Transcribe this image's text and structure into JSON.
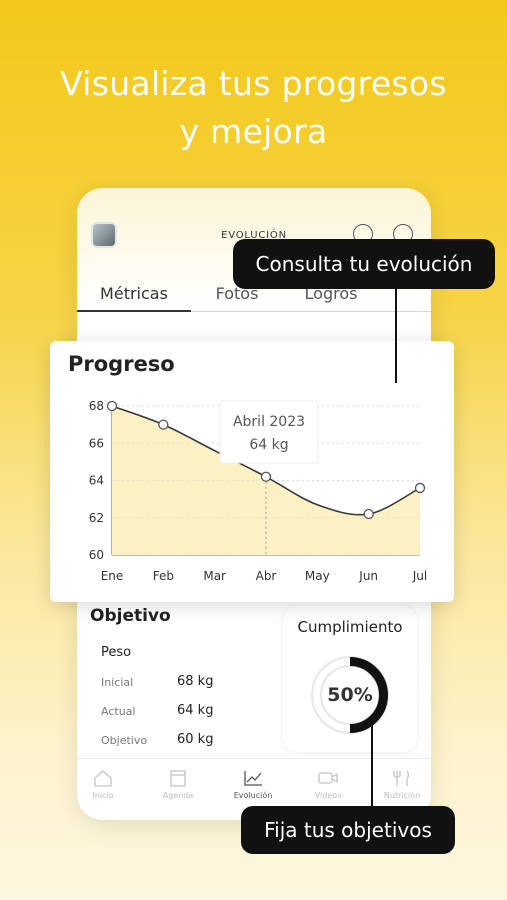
{
  "headline": {
    "line1": "Visualiza  tus progresos",
    "line2": "y mejora"
  },
  "screen": {
    "title": "EVOLUCIÓN",
    "tabs": [
      {
        "label": "Métricas",
        "active": true
      },
      {
        "label": "Fotos",
        "active": false
      },
      {
        "label": "Logros",
        "active": false
      }
    ]
  },
  "progress": {
    "title": "Progreso",
    "tooltip": {
      "date": "Abril 2023",
      "value": "64 kg"
    }
  },
  "chart_data": {
    "type": "line",
    "title": "Progreso",
    "categories": [
      "Ene",
      "Feb",
      "Mar",
      "Abr",
      "May",
      "Jun",
      "Jul"
    ],
    "points": [
      {
        "category": "Ene",
        "value": 68
      },
      {
        "category": "Feb",
        "value": 67
      },
      {
        "category": "Abr",
        "value": 64.2
      },
      {
        "category": "Jun",
        "value": 62.2
      },
      {
        "category": "Jul",
        "value": 63.6
      }
    ],
    "curve": [
      {
        "category": "Ene",
        "value": 68
      },
      {
        "category": "Feb",
        "value": 67
      },
      {
        "category": "Mar",
        "value": 65.6
      },
      {
        "category": "Abr",
        "value": 64.2
      },
      {
        "category": "May",
        "value": 62.7
      },
      {
        "category": "Jun",
        "value": 62.2
      },
      {
        "category": "Jul",
        "value": 63.6
      }
    ],
    "yticks": [
      68,
      66,
      64,
      62,
      60
    ],
    "ylim": [
      60,
      68
    ],
    "highlight_category": "Abr",
    "colors": {
      "line": "#3a3a3a",
      "fill": "#fbf1c4",
      "grid": "#d9d9d9"
    }
  },
  "objective": {
    "title": "Objetivo",
    "subtitle": "Peso",
    "rows": [
      {
        "label": "Inicial",
        "value": "68 kg"
      },
      {
        "label": "Actual",
        "value": "64 kg"
      },
      {
        "label": "Objetivo",
        "value": "60 kg"
      }
    ]
  },
  "compliance": {
    "title": "Cumplimiento",
    "percent_label": "50%",
    "fraction": 0.5
  },
  "nav": [
    {
      "label": "Inicio",
      "icon": "home-icon"
    },
    {
      "label": "Agenda",
      "icon": "calendar-icon"
    },
    {
      "label": "Evolución",
      "icon": "chart-icon",
      "active": true
    },
    {
      "label": "Videos",
      "icon": "video-icon"
    },
    {
      "label": "Nutrición",
      "icon": "cutlery-icon"
    }
  ],
  "callouts": {
    "evolution": "Consulta tu evolución",
    "goals": "Fija tus objetivos"
  },
  "colors": {
    "background": "#f3c81a",
    "accent": "#111111"
  }
}
